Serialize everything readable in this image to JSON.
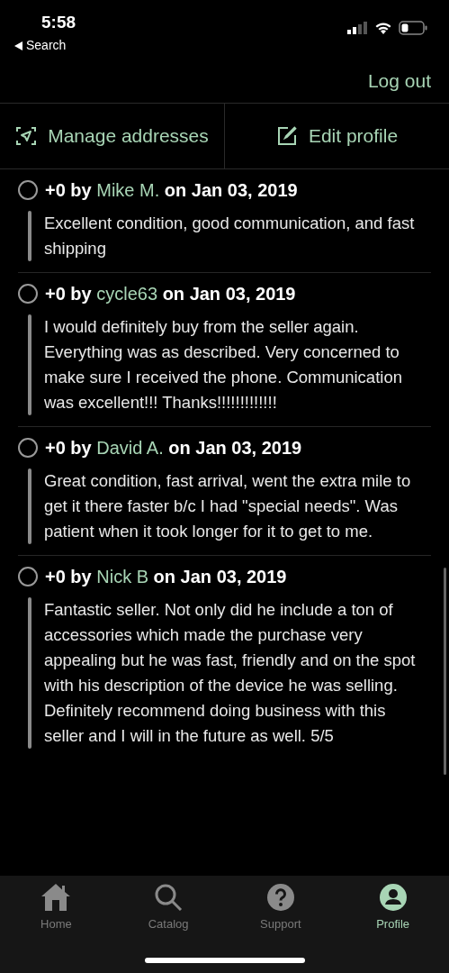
{
  "status_bar": {
    "time": "5:58",
    "back_label": "Search"
  },
  "header": {
    "logout": "Log out"
  },
  "actions": [
    {
      "kind": "addresses",
      "label": "Manage addresses"
    },
    {
      "kind": "edit",
      "label": "Edit profile"
    }
  ],
  "reviews": [
    {
      "selected": false,
      "prefix": "+0 by",
      "author": "Mike M.",
      "suffix": "on Jan 03, 2019",
      "text": "Excellent condition, good communication, and fast shipping"
    },
    {
      "selected": false,
      "prefix": "+0 by",
      "author": "cycle63",
      "suffix": "on Jan 03, 2019",
      "text": "I would definitely buy from the seller again. Everything was as described.  Very concerned to make sure I received the phone.  Communication was excellent!!! Thanks!!!!!!!!!!!!!"
    },
    {
      "selected": false,
      "prefix": "+0 by",
      "author": "David A.",
      "suffix": "on Jan 03, 2019",
      "text": "Great condition, fast arrival, went the extra mile to get it there faster b/c I had \"special needs\".  Was patient when it took longer for it to get to me."
    },
    {
      "selected": false,
      "prefix": "+0 by",
      "author": "Nick B",
      "suffix": "on Jan 03, 2019",
      "text": "Fantastic seller. Not only did he include a ton of accessories which made the purchase very appealing but he was fast, friendly and on the spot with his description of the device he was selling. Definitely recommend doing business with this seller and I will in the future as well. 5/5"
    }
  ],
  "tabs": [
    {
      "kind": "home",
      "label": "Home",
      "selected": false
    },
    {
      "kind": "catalog",
      "label": "Catalog",
      "selected": false
    },
    {
      "kind": "support",
      "label": "Support",
      "selected": false
    },
    {
      "kind": "profile",
      "label": "Profile",
      "selected": true
    }
  ]
}
